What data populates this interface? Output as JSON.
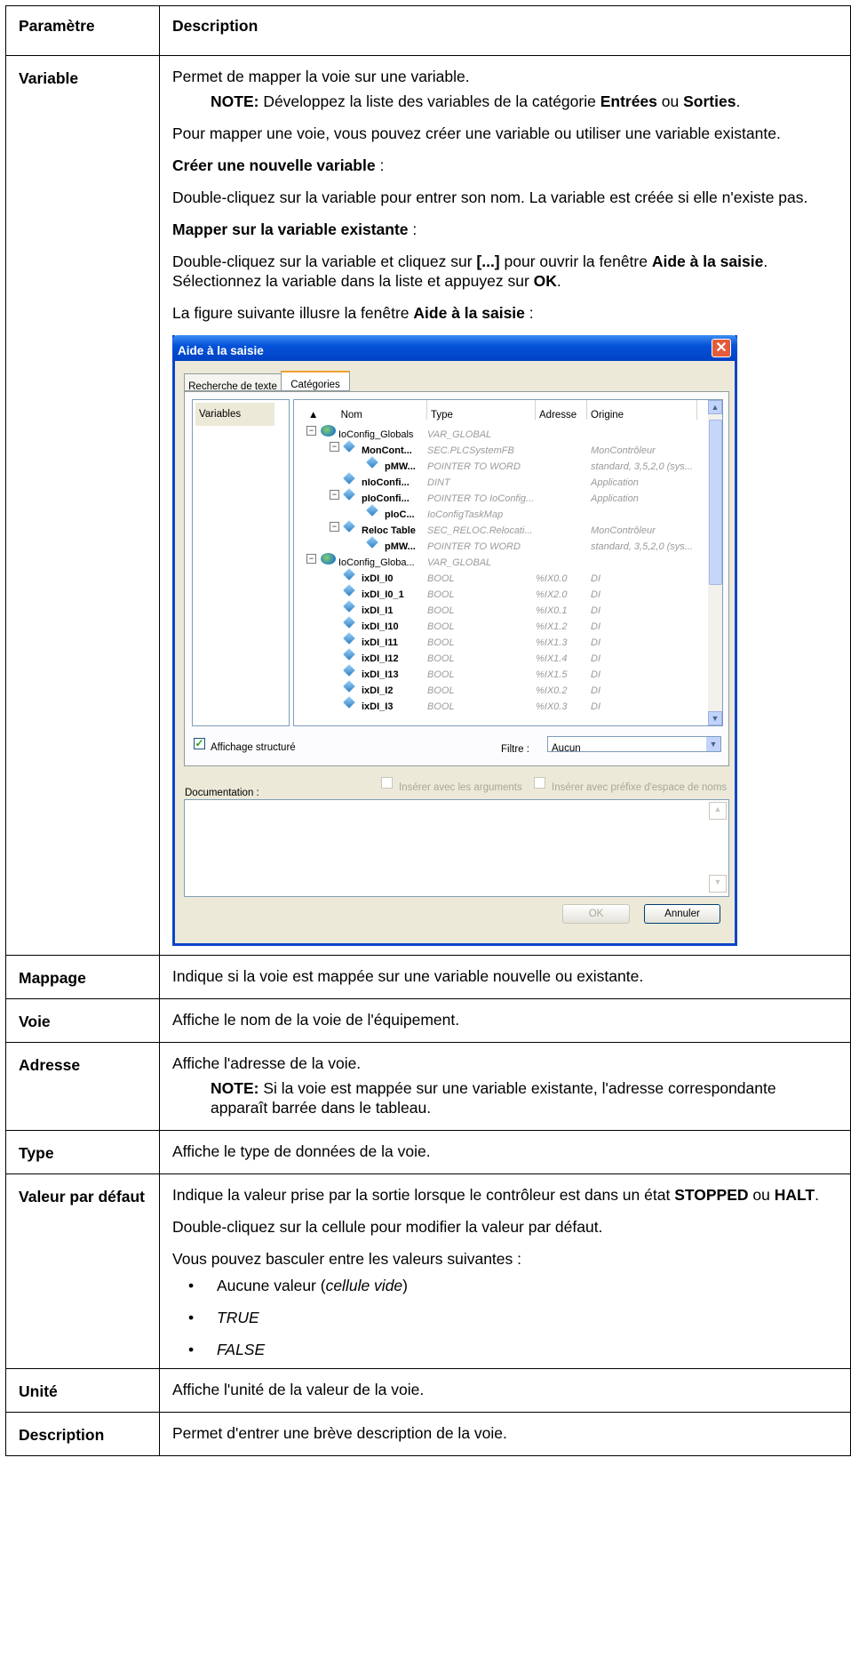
{
  "header": {
    "param": "Paramètre",
    "desc": "Description"
  },
  "variable": {
    "label": "Variable",
    "p1": "Permet de mapper la voie sur une variable.",
    "note_label": "NOTE:",
    "note_a": " Développez la liste des variables de la catégorie ",
    "note_b": "Entrées",
    "note_c": " ou ",
    "note_d": "Sorties",
    "note_e": ".",
    "p2": "Pour mapper une voie, vous pouvez créer une variable ou utiliser une variable existante.",
    "create_b": "Créer une nouvelle variable",
    "create_t": " :",
    "p3": "Double-cliquez sur la variable pour entrer son nom. La variable est créée si elle n'existe pas.",
    "map_b": "Mapper sur la variable existante",
    "map_t": " :",
    "p4a": "Double-cliquez sur la variable et cliquez sur ",
    "p4b": "[...]",
    "p4c": " pour ouvrir la fenêtre ",
    "p4d": "Aide à la saisie",
    "p4e": ". Sélectionnez la variable dans la liste et appuyez sur ",
    "p4f": "OK",
    "p4g": ".",
    "p5a": "La figure suivante illusre la fenêtre ",
    "p5b": "Aide à la saisie",
    "p5c": " :"
  },
  "dialog": {
    "title": "Aide à la saisie",
    "close": "✕",
    "tabs": [
      "Recherche de texte",
      "Catégories"
    ],
    "left_item": "Variables",
    "columns": [
      "Nom",
      "Type",
      "Adresse",
      "Origine"
    ],
    "sort_glyph": "▲",
    "rows": [
      {
        "name": "IoConfig_Globals",
        "type": "VAR_GLOBAL",
        "addr": "",
        "origin": ""
      },
      {
        "name": "MonCont...",
        "type": "SEC.PLCSystemFB",
        "addr": "",
        "origin": "MonContrôleur"
      },
      {
        "name": "pMW...",
        "type": "POINTER TO WORD",
        "addr": "",
        "origin": "standard, 3,5,2,0 (sys..."
      },
      {
        "name": "nIoConfi...",
        "type": "DINT",
        "addr": "",
        "origin": "Application"
      },
      {
        "name": "pIoConfi...",
        "type": "POINTER TO IoConfig...",
        "addr": "",
        "origin": "Application"
      },
      {
        "name": "pIoC...",
        "type": "IoConfigTaskMap",
        "addr": "",
        "origin": ""
      },
      {
        "name": "Reloc Table",
        "type": "SEC_RELOC.Relocati...",
        "addr": "",
        "origin": "MonContrôleur"
      },
      {
        "name": "pMW...",
        "type": "POINTER TO WORD",
        "addr": "",
        "origin": "standard, 3,5,2,0 (sys..."
      },
      {
        "name": "IoConfig_Globa...",
        "type": "VAR_GLOBAL",
        "addr": "",
        "origin": ""
      },
      {
        "name": "ixDI_I0",
        "type": "BOOL",
        "addr": "%IX0.0",
        "origin": "DI"
      },
      {
        "name": "ixDI_I0_1",
        "type": "BOOL",
        "addr": "%IX2.0",
        "origin": "DI"
      },
      {
        "name": "ixDI_I1",
        "type": "BOOL",
        "addr": "%IX0.1",
        "origin": "DI"
      },
      {
        "name": "ixDI_I10",
        "type": "BOOL",
        "addr": "%IX1.2",
        "origin": "DI"
      },
      {
        "name": "ixDI_I11",
        "type": "BOOL",
        "addr": "%IX1.3",
        "origin": "DI"
      },
      {
        "name": "ixDI_I12",
        "type": "BOOL",
        "addr": "%IX1.4",
        "origin": "DI"
      },
      {
        "name": "ixDI_I13",
        "type": "BOOL",
        "addr": "%IX1.5",
        "origin": "DI"
      },
      {
        "name": "ixDI_I2",
        "type": "BOOL",
        "addr": "%IX0.2",
        "origin": "DI"
      },
      {
        "name": "ixDI_I3",
        "type": "BOOL",
        "addr": "%IX0.3",
        "origin": "DI"
      }
    ],
    "structured_label": "Affichage structuré",
    "structured_check": "✓",
    "filter_label": "Filtre :",
    "filter_value": "Aucun",
    "insert_args": "Insérer avec les arguments",
    "insert_prefix": "Insérer avec préfixe d'espace de noms",
    "documentation_label": "Documentation :",
    "ok": "OK",
    "cancel": "Annuler",
    "arrow_up": "▲",
    "arrow_down": "▼"
  },
  "mappage": {
    "label": "Mappage",
    "desc": "Indique si la voie est mappée sur une variable nouvelle ou existante."
  },
  "voie": {
    "label": "Voie",
    "desc": "Affiche le nom de la voie de l'équipement."
  },
  "adresse": {
    "label": "Adresse",
    "desc": "Affiche l'adresse de la voie.",
    "note_label": "NOTE:",
    "note_text": " Si la voie est mappée sur une variable existante, l'adresse correspondante apparaît barrée dans le tableau."
  },
  "type": {
    "label": "Type",
    "desc": "Affiche le type de données de la voie."
  },
  "valeur": {
    "label": "Valeur par défaut",
    "p1a": "Indique la valeur prise par la sortie lorsque le contrôleur est dans un état ",
    "p1b": "STOPPED",
    "p1c": " ou ",
    "p1d": "HALT",
    "p1e": ".",
    "p2": "Double-cliquez sur la cellule pour modifier la valeur par défaut.",
    "p3": "Vous pouvez basculer entre les valeurs suivantes :",
    "item1a": "Aucune valeur (",
    "item1b": "cellule vide",
    "item1c": ")",
    "item2": "TRUE",
    "item3": "FALSE"
  },
  "unite": {
    "label": "Unité",
    "desc": "Affiche l'unité de la valeur de la voie."
  },
  "description": {
    "label": "Description",
    "desc": "Permet d'entrer une brève description de la voie."
  }
}
